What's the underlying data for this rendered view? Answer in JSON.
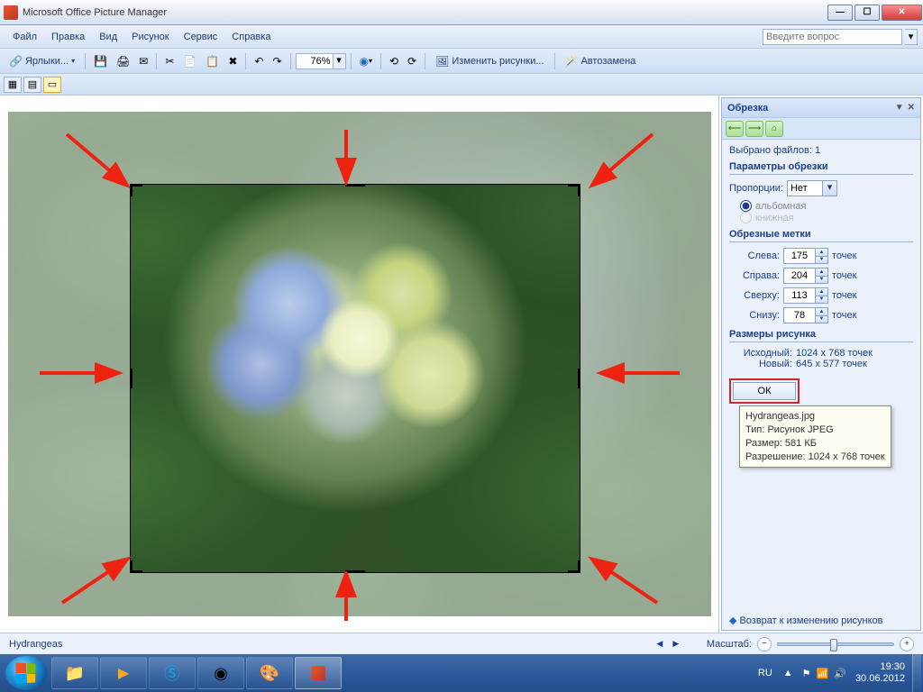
{
  "app_title": "Microsoft Office Picture Manager",
  "menu": [
    "Файл",
    "Правка",
    "Вид",
    "Рисунок",
    "Сервис",
    "Справка"
  ],
  "ask_placeholder": "Введите вопрос",
  "toolbar": {
    "shortcuts_label": "Ярлыки...",
    "zoom_value": "76%",
    "edit_pictures_label": "Изменить рисунки...",
    "auto_correct_label": "Автозамена"
  },
  "sidepanel": {
    "title": "Обрезка",
    "selected_files_label": "Выбрано файлов:",
    "selected_files_count": 1,
    "params_heading": "Параметры обрезки",
    "aspect_label": "Пропорции:",
    "aspect_value": "Нет",
    "orient_landscape": "альбомная",
    "orient_portrait": "книжная",
    "marks_heading": "Обрезные метки",
    "left_label": "Слева:",
    "left_value": 175,
    "right_label": "Справа:",
    "right_value": 204,
    "top_label": "Сверху:",
    "top_value": 113,
    "bottom_label": "Снизу:",
    "bottom_value": 78,
    "unit": "точек",
    "sizes_heading": "Размеры рисунка",
    "original_label": "Исходный:",
    "original_value": "1024 x 768 точек",
    "new_label": "Новый:",
    "new_value": "645 x 577 точек",
    "ok_label": "ОК",
    "back_label": "Возврат к изменению рисунков"
  },
  "tooltip": {
    "filename": "Hydrangeas.jpg",
    "type_label": "Тип: Рисунок JPEG",
    "size_label": "Размер: 581 КБ",
    "resolution_label": "Разрешение: 1024 x 768 точек"
  },
  "statusbar": {
    "filename": "Hydrangeas",
    "zoom_label": "Масштаб:"
  },
  "taskbar": {
    "lang": "RU",
    "time": "19:30",
    "date": "30.06.2012"
  }
}
